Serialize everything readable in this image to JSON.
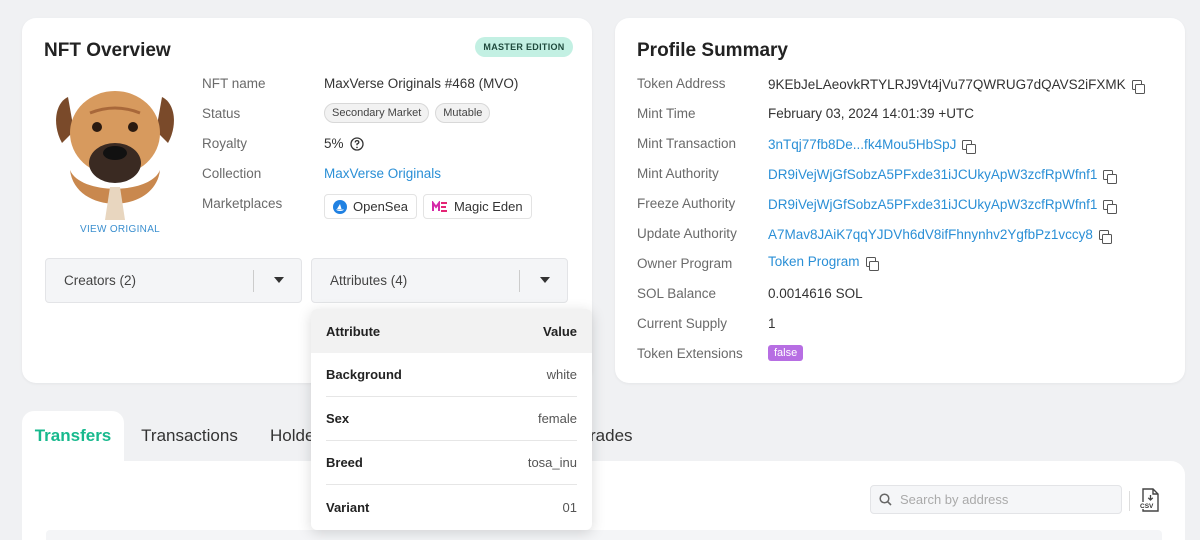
{
  "nft_overview": {
    "title": "NFT Overview",
    "badge": "MASTER EDITION",
    "view_original": "VIEW ORIGINAL",
    "rows": [
      {
        "label": "NFT name",
        "value": "MaxVerse Originals #468 (MVO)"
      },
      {
        "label": "Status",
        "pills": [
          "Secondary Market",
          "Mutable"
        ]
      },
      {
        "label": "Royalty",
        "value": "5%"
      },
      {
        "label": "Collection",
        "value": "MaxVerse Originals"
      },
      {
        "label": "Marketplaces",
        "markets": [
          "OpenSea",
          "Magic Eden"
        ]
      }
    ],
    "creators_label": "Creators (2)",
    "attributes_label": "Attributes (4)"
  },
  "attributes_popup": {
    "header_attribute": "Attribute",
    "header_value": "Value",
    "rows": [
      {
        "k": "Background",
        "v": "white"
      },
      {
        "k": "Sex",
        "v": "female"
      },
      {
        "k": "Breed",
        "v": "tosa_inu"
      },
      {
        "k": "Variant",
        "v": "01"
      }
    ]
  },
  "profile_summary": {
    "title": "Profile Summary",
    "rows": [
      {
        "label": "Token Address",
        "value": "9KEbJeLAeovkRTYLRJ9Vt4jVu77QWRUG7dQAVS2iFXMK"
      },
      {
        "label": "Mint Time",
        "value": "February 03, 2024 14:01:39 +UTC"
      },
      {
        "label": "Mint Transaction",
        "value": "3nTqj77fb8De...fk4Mou5HbSpJ"
      },
      {
        "label": "Mint Authority",
        "value": "DR9iVejWjGfSobzA5PFxde31iJCUkyApW3zcfRpWfnf1"
      },
      {
        "label": "Freeze Authority",
        "value": "DR9iVejWjGfSobzA5PFxde31iJCUkyApW3zcfRpWfnf1"
      },
      {
        "label": "Update Authority",
        "value": "A7Mav8JAiK7qqYJDVh6dV8ifFhnynhv2YgfbPz1vccy8"
      },
      {
        "label": "Owner Program",
        "value": "Token Program"
      },
      {
        "label": "SOL Balance",
        "value": "0.0014616 SOL"
      },
      {
        "label": "Current Supply",
        "value": "1"
      },
      {
        "label": "Token Extensions",
        "value": "false"
      }
    ]
  },
  "tabs": [
    "Transfers",
    "Transactions",
    "Holde",
    "rades"
  ],
  "search": {
    "placeholder": "Search by address"
  },
  "colors": {
    "accent": "#17b98d",
    "link": "#2a8fd6",
    "badge_bg": "#c3f0e3",
    "false_badge": "#b76ee3"
  }
}
